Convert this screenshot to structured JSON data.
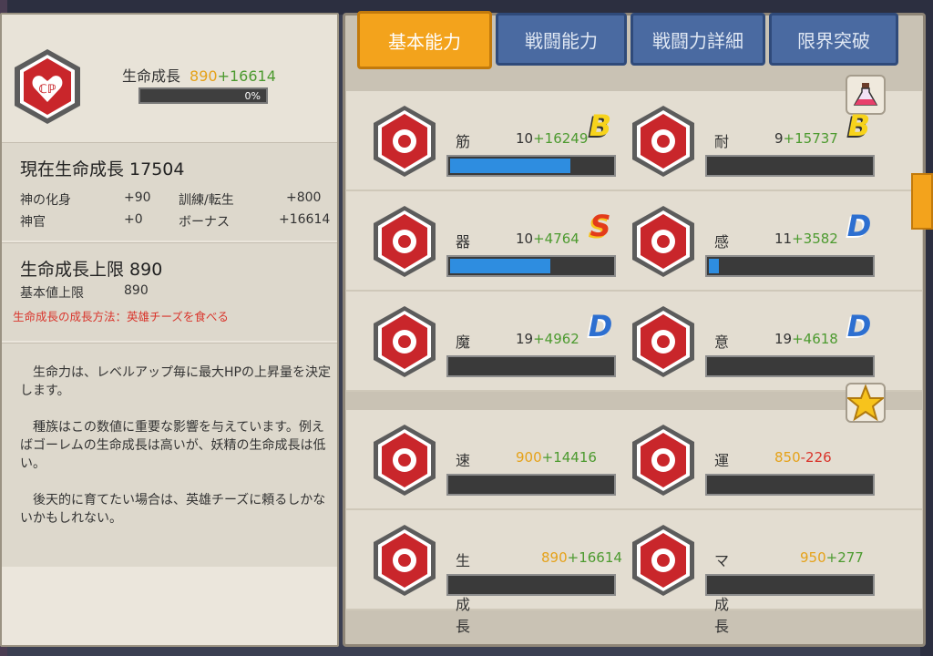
{
  "tabs": [
    {
      "label": "基本能力",
      "active": true
    },
    {
      "label": "戦闘能力",
      "active": false
    },
    {
      "label": "戦闘力詳細",
      "active": false
    },
    {
      "label": "限界突破",
      "active": false
    }
  ],
  "left": {
    "icon": "heart-icon",
    "title": "生命成長",
    "base": "890",
    "bonus": "+16614",
    "progress_text": "0%",
    "current": {
      "heading": "現在生命成長 17504",
      "rows": [
        {
          "k": "神の化身",
          "v": "+90",
          "k2": "訓練/転生",
          "v2": "+800"
        },
        {
          "k": "神官",
          "v": "+0",
          "k2": "ボーナス",
          "v2": "+16614"
        }
      ]
    },
    "limit": {
      "heading": "生命成長上限 890",
      "k": "基本値上限",
      "v": "890",
      "tip": "生命成長の成長方法：英雄チーズを食べる"
    },
    "description": [
      "生命力は、レベルアップ毎に最大HPの上昇量を決定します。",
      "種族はこの数値に重要な影響を与えています。例えばゴーレムの生命成長は高いが、妖精の生命成長は低い。",
      "後天的に育てたい場合は、英雄チーズに頼るしかないかもしれない。"
    ]
  },
  "stats": [
    {
      "label": "筋力",
      "base": "10",
      "bonus": "+16249",
      "grade": "B",
      "fill": 0.74,
      "icon": "muscle-arm-icon"
    },
    {
      "label": "耐久",
      "base": "9",
      "bonus": "+15737",
      "grade": "B",
      "fill": 0.0,
      "icon": "body-torso-icon"
    },
    {
      "label": "器用",
      "base": "10",
      "bonus": "+4764",
      "grade": "S",
      "fill": 0.62,
      "icon": "running-man-icon"
    },
    {
      "label": "感覚",
      "base": "11",
      "bonus": "+3582",
      "grade": "D",
      "fill": 0.06,
      "icon": "eye-icon"
    },
    {
      "label": "魔力",
      "base": "19",
      "bonus": "+4962",
      "grade": "D",
      "fill": 0.0,
      "icon": "magic-swirl-icon"
    },
    {
      "label": "意思",
      "base": "19",
      "bonus": "+4618",
      "grade": "D",
      "fill": 0.0,
      "icon": "head-silhouette-icon"
    },
    {
      "label": "速度",
      "base": "900",
      "bonus": "+14416",
      "grade": "",
      "fill": 0.0,
      "icon": "wing-speed-icon"
    },
    {
      "label": "運勢",
      "base": "850",
      "bonus": "-226",
      "grade": "",
      "fill": 0.0,
      "icon": "clover-icon"
    },
    {
      "label": "生命成長",
      "base": "890",
      "bonus": "+16614",
      "grade": "",
      "fill": 0.0,
      "icon": "heart-icon"
    },
    {
      "label": "マナ成長",
      "base": "950",
      "bonus": "+277",
      "grade": "",
      "fill": 0.0,
      "icon": "mana-sigil-icon"
    }
  ],
  "colors": {
    "accent": "#f3a31c",
    "tab_blue": "#4a6aa1",
    "hex_red": "#c9262b",
    "bar_blue": "#2e8de0"
  }
}
